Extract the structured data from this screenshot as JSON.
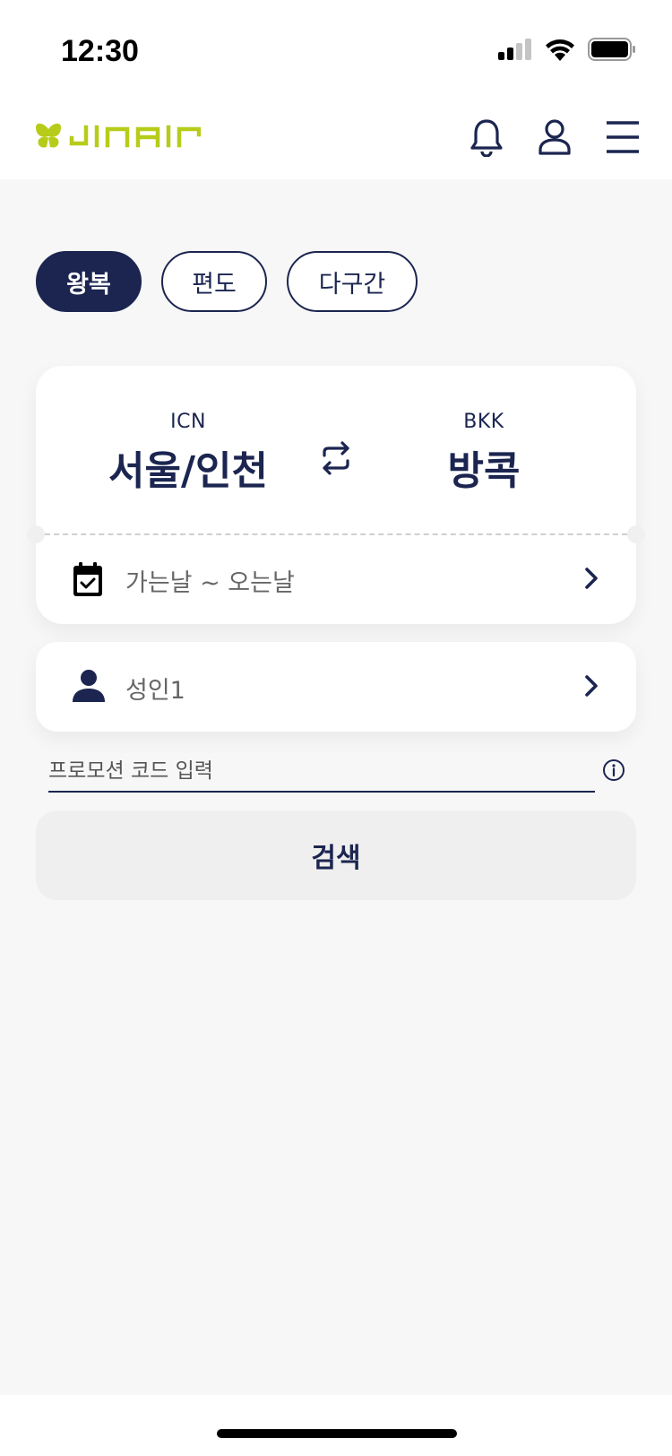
{
  "status_bar": {
    "time": "12:30",
    "icons": [
      "cellular-signal-icon",
      "wifi-icon",
      "battery-icon"
    ]
  },
  "header": {
    "logo_text": "JINAIR",
    "icons": [
      "bell-icon",
      "user-icon",
      "menu-icon"
    ]
  },
  "trip_types": [
    {
      "label": "왕복",
      "active": true
    },
    {
      "label": "편도",
      "active": false
    },
    {
      "label": "다구간",
      "active": false
    }
  ],
  "route": {
    "origin": {
      "code": "ICN",
      "city": "서울/인천"
    },
    "destination": {
      "code": "BKK",
      "city": "방콕"
    },
    "swap_icon": "swap-icon"
  },
  "dates": {
    "label": "가는날 ~ 오는날",
    "icon": "calendar-check-icon"
  },
  "passengers": {
    "label": "성인1",
    "icon": "person-icon"
  },
  "promo": {
    "placeholder": "프로모션 코드 입력",
    "value": "",
    "info_icon": "info-icon"
  },
  "search": {
    "label": "검색"
  },
  "colors": {
    "navy": "#1b2550",
    "brand_lime": "#b7cc1a",
    "background": "#f7f7f7",
    "card": "#ffffff",
    "search_button_bg": "#efefef"
  }
}
